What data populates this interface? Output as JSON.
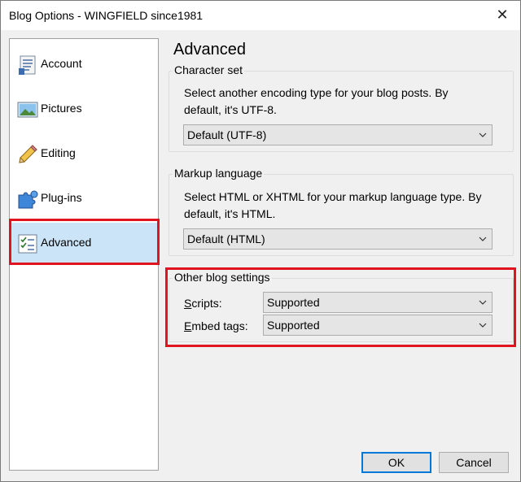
{
  "window": {
    "title": "Blog Options - WINGFIELD since1981",
    "close_label": "✕"
  },
  "sidebar": {
    "items": [
      {
        "label": "Account",
        "icon": "account-icon"
      },
      {
        "label": "Pictures",
        "icon": "pictures-icon"
      },
      {
        "label": "Editing",
        "icon": "pencil-icon"
      },
      {
        "label": "Plug-ins",
        "icon": "puzzle-icon"
      },
      {
        "label": "Advanced",
        "icon": "checklist-icon",
        "selected": true
      }
    ]
  },
  "main": {
    "title": "Advanced",
    "character_set": {
      "label": "Character set",
      "description_line1": "Select another encoding type for your blog posts. By",
      "description_line2": "default, it's UTF-8.",
      "selected": "Default (UTF-8)"
    },
    "markup_language": {
      "label": "Markup language",
      "description_line1": "Select HTML or XHTML for your markup language type. By",
      "description_line2": "default, it's HTML.",
      "selected": "Default (HTML)"
    },
    "other": {
      "label": "Other blog settings",
      "scripts_label_prefix": "S",
      "scripts_label_rest": "cripts:",
      "scripts_value": "Supported",
      "embed_label_prefix": "E",
      "embed_label_rest": "mbed tags:",
      "embed_value": "Supported"
    }
  },
  "footer": {
    "ok_label": "OK",
    "cancel_label": "Cancel"
  },
  "colors": {
    "highlight": "#e0141e",
    "selection": "#cce4f7",
    "default_button_border": "#0078d7"
  }
}
